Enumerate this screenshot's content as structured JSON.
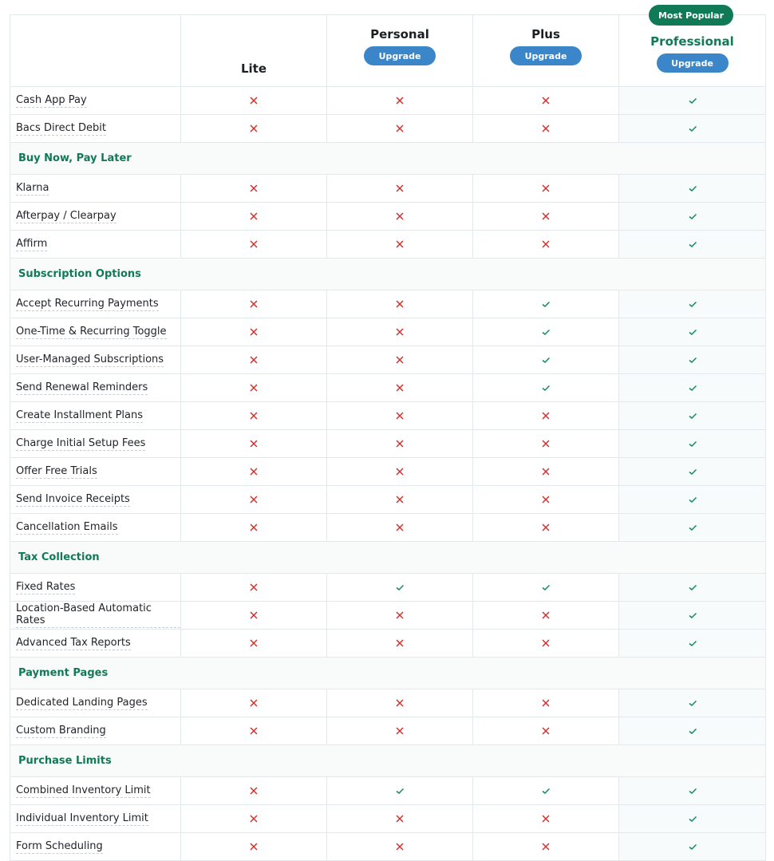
{
  "colors": {
    "accent_green": "#117a55",
    "badge_green": "#107a57",
    "button_blue": "#3b86c9",
    "cross_red": "#d0312d",
    "check_green": "#138a5e"
  },
  "plans": [
    {
      "name": "Lite",
      "button": null
    },
    {
      "name": "Personal",
      "button": "Upgrade"
    },
    {
      "name": "Plus",
      "button": "Upgrade"
    },
    {
      "name": "Professional",
      "button": "Upgrade",
      "badge": "Most Popular",
      "highlighted": true
    }
  ],
  "rows": [
    {
      "type": "feature",
      "label": "Cash App Pay",
      "values": [
        false,
        false,
        false,
        true
      ]
    },
    {
      "type": "feature",
      "label": "Bacs Direct Debit",
      "values": [
        false,
        false,
        false,
        true
      ]
    },
    {
      "type": "section",
      "label": "Buy Now, Pay Later"
    },
    {
      "type": "feature",
      "label": "Klarna",
      "values": [
        false,
        false,
        false,
        true
      ]
    },
    {
      "type": "feature",
      "label": "Afterpay / Clearpay",
      "values": [
        false,
        false,
        false,
        true
      ]
    },
    {
      "type": "feature",
      "label": "Affirm",
      "values": [
        false,
        false,
        false,
        true
      ]
    },
    {
      "type": "section",
      "label": "Subscription Options"
    },
    {
      "type": "feature",
      "label": "Accept Recurring Payments",
      "values": [
        false,
        false,
        true,
        true
      ]
    },
    {
      "type": "feature",
      "label": "One-Time & Recurring Toggle",
      "values": [
        false,
        false,
        true,
        true
      ]
    },
    {
      "type": "feature",
      "label": "User-Managed Subscriptions",
      "values": [
        false,
        false,
        true,
        true
      ]
    },
    {
      "type": "feature",
      "label": "Send Renewal Reminders",
      "values": [
        false,
        false,
        true,
        true
      ]
    },
    {
      "type": "feature",
      "label": "Create Installment Plans",
      "values": [
        false,
        false,
        false,
        true
      ]
    },
    {
      "type": "feature",
      "label": "Charge Initial Setup Fees",
      "values": [
        false,
        false,
        false,
        true
      ]
    },
    {
      "type": "feature",
      "label": "Offer Free Trials",
      "values": [
        false,
        false,
        false,
        true
      ]
    },
    {
      "type": "feature",
      "label": "Send Invoice Receipts",
      "values": [
        false,
        false,
        false,
        true
      ]
    },
    {
      "type": "feature",
      "label": "Cancellation Emails",
      "values": [
        false,
        false,
        false,
        true
      ]
    },
    {
      "type": "section",
      "label": "Tax Collection"
    },
    {
      "type": "feature",
      "label": "Fixed Rates",
      "values": [
        false,
        true,
        true,
        true
      ]
    },
    {
      "type": "feature",
      "label": "Location-Based Automatic Rates",
      "values": [
        false,
        false,
        false,
        true
      ]
    },
    {
      "type": "feature",
      "label": "Advanced Tax Reports",
      "values": [
        false,
        false,
        false,
        true
      ]
    },
    {
      "type": "section",
      "label": "Payment Pages"
    },
    {
      "type": "feature",
      "label": "Dedicated Landing Pages",
      "values": [
        false,
        false,
        false,
        true
      ]
    },
    {
      "type": "feature",
      "label": "Custom Branding",
      "values": [
        false,
        false,
        false,
        true
      ]
    },
    {
      "type": "section",
      "label": "Purchase Limits"
    },
    {
      "type": "feature",
      "label": "Combined Inventory Limit",
      "values": [
        false,
        true,
        true,
        true
      ]
    },
    {
      "type": "feature",
      "label": "Individual Inventory Limit",
      "values": [
        false,
        false,
        false,
        true
      ]
    },
    {
      "type": "feature",
      "label": "Form Scheduling",
      "values": [
        false,
        false,
        false,
        true
      ]
    }
  ]
}
